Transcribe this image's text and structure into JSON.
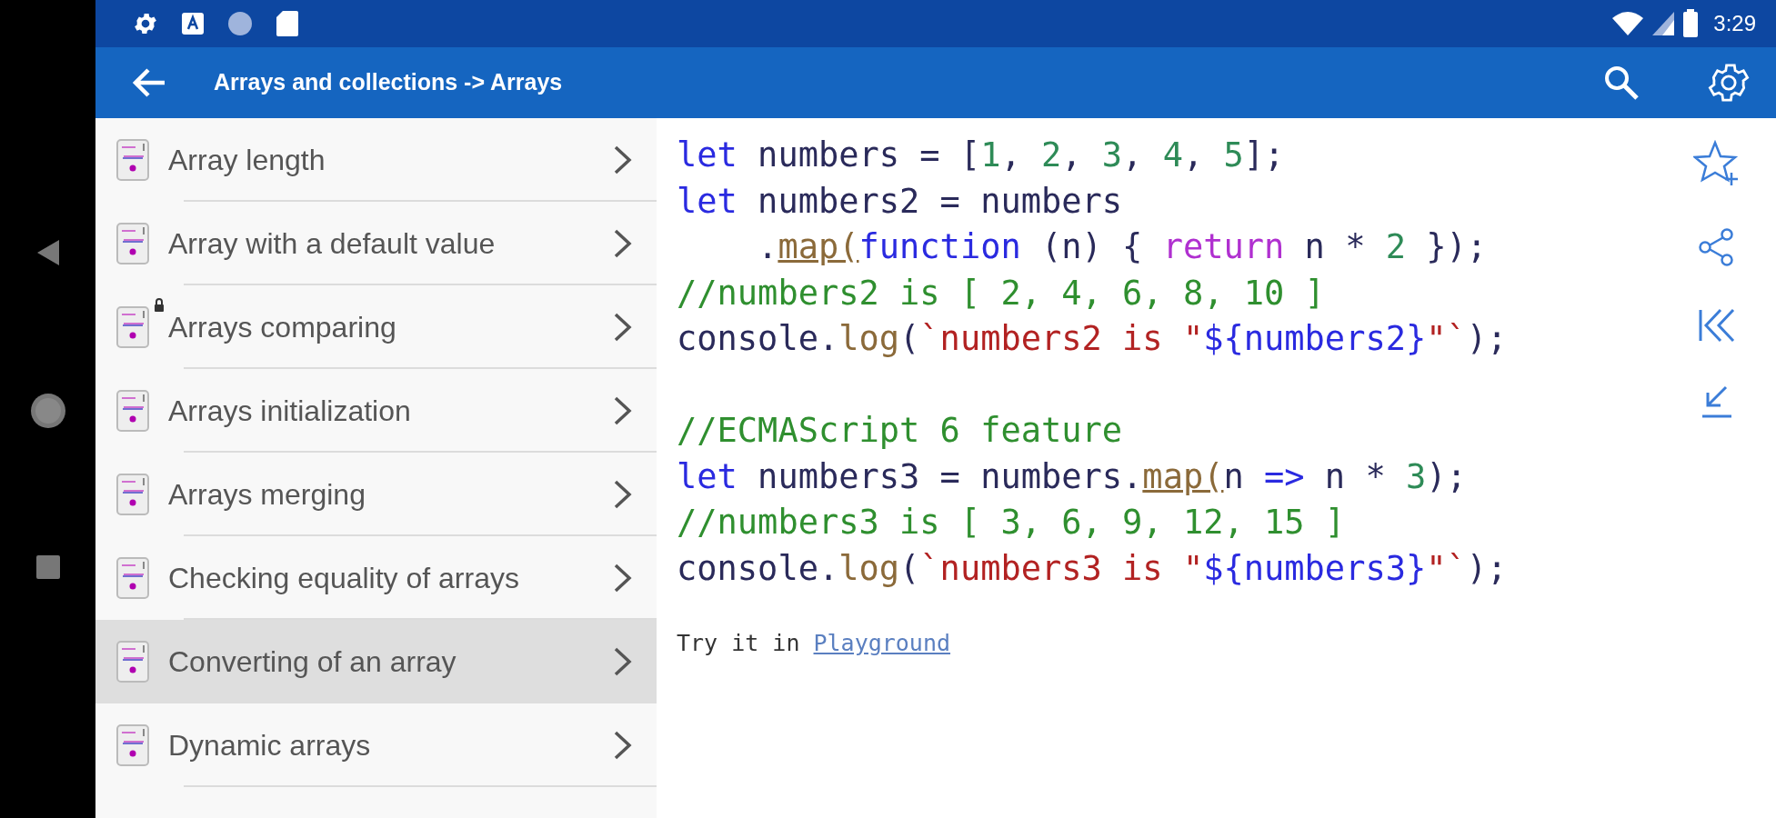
{
  "status_bar": {
    "time": "3:29"
  },
  "app_bar": {
    "title": "Arrays and collections -> Arrays"
  },
  "topics": [
    {
      "label": "Array length",
      "selected": false,
      "locked": false
    },
    {
      "label": "Array with a default value",
      "selected": false,
      "locked": false
    },
    {
      "label": "Arrays comparing",
      "selected": false,
      "locked": true
    },
    {
      "label": "Arrays initialization",
      "selected": false,
      "locked": false
    },
    {
      "label": "Arrays merging",
      "selected": false,
      "locked": false
    },
    {
      "label": "Checking equality of arrays",
      "selected": false,
      "locked": false
    },
    {
      "label": "Converting of an array",
      "selected": true,
      "locked": false
    },
    {
      "label": "Dynamic arrays",
      "selected": false,
      "locked": false
    }
  ],
  "code_lines": [
    {
      "kind": "code",
      "tokens": [
        {
          "kind": "keyword",
          "text": "let"
        },
        {
          "kind": "plain",
          "text": " numbers = ["
        },
        {
          "kind": "number",
          "text": "1"
        },
        {
          "kind": "plain",
          "text": ", "
        },
        {
          "kind": "number",
          "text": "2"
        },
        {
          "kind": "plain",
          "text": ", "
        },
        {
          "kind": "number",
          "text": "3"
        },
        {
          "kind": "plain",
          "text": ", "
        },
        {
          "kind": "number",
          "text": "4"
        },
        {
          "kind": "plain",
          "text": ", "
        },
        {
          "kind": "number",
          "text": "5"
        },
        {
          "kind": "plain",
          "text": "];"
        }
      ]
    },
    {
      "kind": "code",
      "tokens": [
        {
          "kind": "keyword",
          "text": "let"
        },
        {
          "kind": "plain",
          "text": " numbers2 = numbers"
        }
      ]
    },
    {
      "kind": "code",
      "tokens": [
        {
          "kind": "plain",
          "text": "    ."
        },
        {
          "kind": "method",
          "text": "map("
        },
        {
          "kind": "keyword",
          "text": "function"
        },
        {
          "kind": "plain",
          "text": " (n) { "
        },
        {
          "kind": "return",
          "text": "return"
        },
        {
          "kind": "plain",
          "text": " n * "
        },
        {
          "kind": "number",
          "text": "2"
        },
        {
          "kind": "plain",
          "text": " });"
        }
      ]
    },
    {
      "kind": "code",
      "tokens": [
        {
          "kind": "comment",
          "text": "//numbers2 is [ 2, 4, 6, 8, 10 ]"
        }
      ]
    },
    {
      "kind": "code",
      "tokens": [
        {
          "kind": "plain",
          "text": "console."
        },
        {
          "kind": "call",
          "text": "log"
        },
        {
          "kind": "plain",
          "text": "("
        },
        {
          "kind": "string",
          "text": "`numbers2 is \""
        },
        {
          "kind": "interp",
          "text": "${numbers2}"
        },
        {
          "kind": "string",
          "text": "\"`"
        },
        {
          "kind": "plain",
          "text": ");"
        }
      ]
    },
    {
      "kind": "blank"
    },
    {
      "kind": "code",
      "tokens": [
        {
          "kind": "comment",
          "text": "//ECMAScript 6 feature"
        }
      ]
    },
    {
      "kind": "code",
      "tokens": [
        {
          "kind": "keyword",
          "text": "let"
        },
        {
          "kind": "plain",
          "text": " numbers3 = numbers."
        },
        {
          "kind": "method",
          "text": "map("
        },
        {
          "kind": "plain",
          "text": "n "
        },
        {
          "kind": "keyword",
          "text": "=>"
        },
        {
          "kind": "plain",
          "text": " n * "
        },
        {
          "kind": "number",
          "text": "3"
        },
        {
          "kind": "plain",
          "text": ");"
        }
      ]
    },
    {
      "kind": "code",
      "tokens": [
        {
          "kind": "comment",
          "text": "//numbers3 is [ 3, 6, 9, 12, 15 ]"
        }
      ]
    },
    {
      "kind": "code",
      "tokens": [
        {
          "kind": "plain",
          "text": "console."
        },
        {
          "kind": "call",
          "text": "log"
        },
        {
          "kind": "plain",
          "text": "("
        },
        {
          "kind": "string",
          "text": "`numbers3 is \""
        },
        {
          "kind": "interp",
          "text": "${numbers3}"
        },
        {
          "kind": "string",
          "text": "\"`"
        },
        {
          "kind": "plain",
          "text": ");"
        }
      ]
    }
  ],
  "try_it": {
    "text": "Try it in ",
    "link": "Playground"
  }
}
